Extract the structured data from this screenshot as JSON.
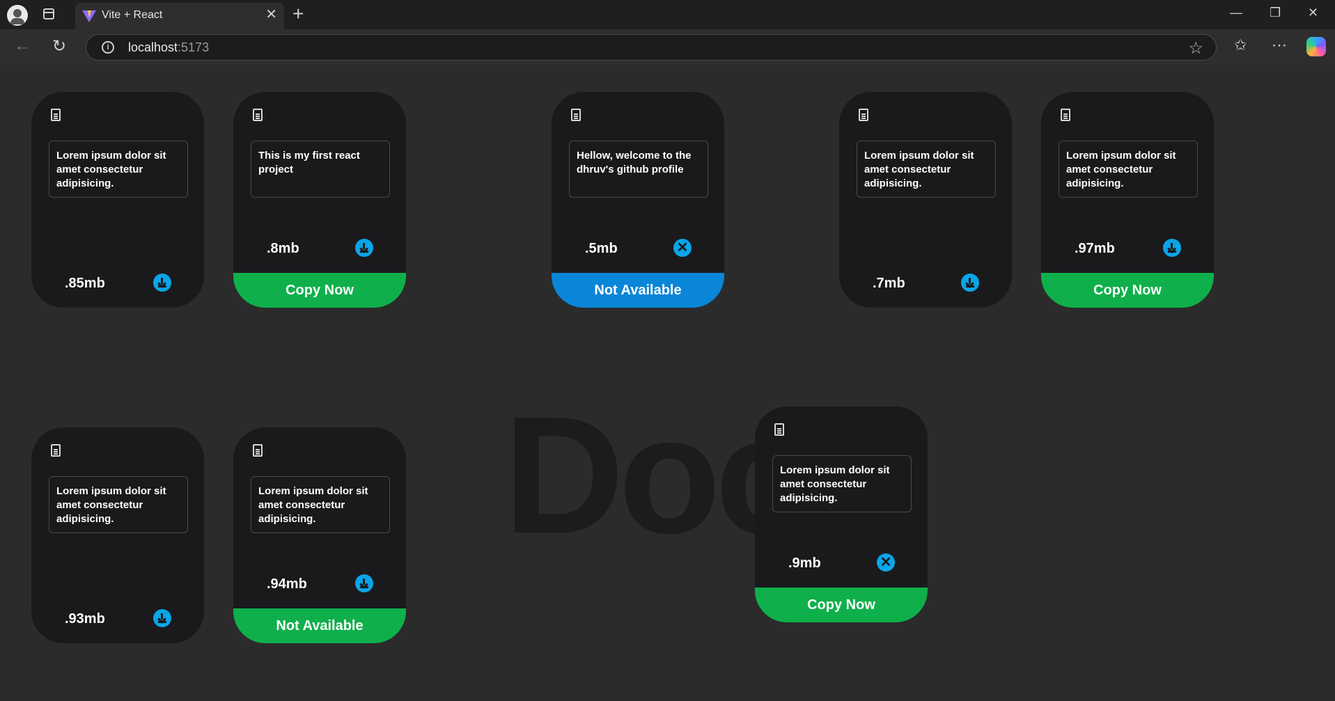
{
  "browser": {
    "tab_title": "Vite + React",
    "url_host": "localhost",
    "url_port": ":5173"
  },
  "watermark": "Docs",
  "cards": [
    {
      "desc": "Lorem ipsum dolor sit amet consectetur adipisicing.",
      "size": ".85mb",
      "action": "download",
      "tag": null
    },
    {
      "desc": "This is my first react project",
      "size": ".8mb",
      "action": "download",
      "tag": {
        "label": "Copy Now",
        "color": "green"
      }
    },
    {
      "desc": "Hellow, welcome to the dhruv's github profile",
      "size": ".5mb",
      "action": "close",
      "tag": {
        "label": "Not Available",
        "color": "blue"
      }
    },
    {
      "desc": "Lorem ipsum dolor sit amet consectetur adipisicing.",
      "size": ".7mb",
      "action": "download",
      "tag": null
    },
    {
      "desc": "Lorem ipsum dolor sit amet consectetur adipisicing.",
      "size": ".97mb",
      "action": "download",
      "tag": {
        "label": "Copy Now",
        "color": "green"
      }
    },
    {
      "desc": "Lorem ipsum dolor sit amet consectetur adipisicing.",
      "size": ".93mb",
      "action": "download",
      "tag": null
    },
    {
      "desc": "Lorem ipsum dolor sit amet consectetur adipisicing.",
      "size": ".94mb",
      "action": "download",
      "tag": {
        "label": "Not Available",
        "color": "green"
      }
    },
    {
      "desc": "Lorem ipsum dolor sit amet consectetur adipisicing.",
      "size": ".9mb",
      "action": "close",
      "tag": {
        "label": "Copy Now",
        "color": "green"
      }
    }
  ],
  "colors": {
    "accent": "#0aa5e8",
    "green": "#0fb04b",
    "blue": "#0a86d8",
    "card_bg": "#1a1a1c",
    "page_bg": "#2b2b2c"
  }
}
